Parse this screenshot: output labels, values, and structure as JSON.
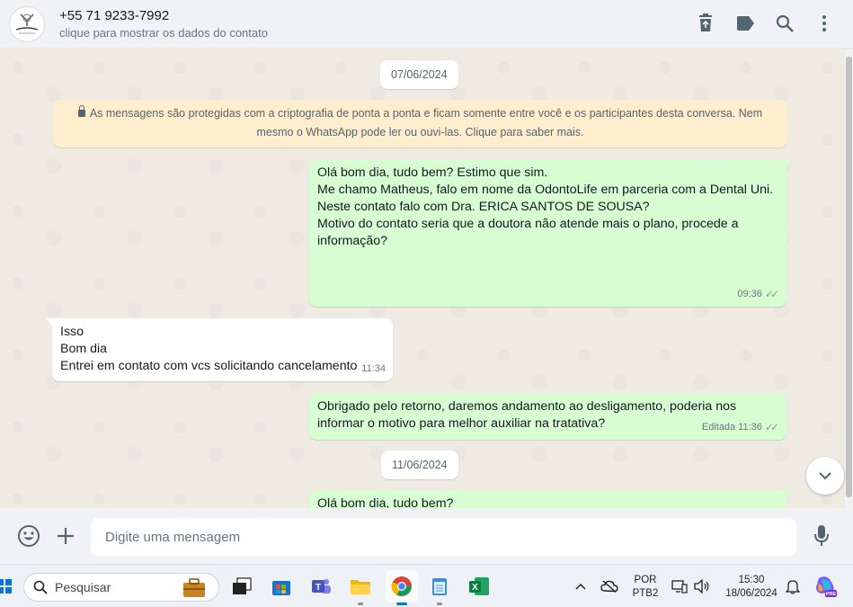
{
  "header": {
    "contact_name": "+55 71 9233-7992",
    "contact_subtitle": "clique para mostrar os dados do contato",
    "icons": [
      "delete-icon",
      "label-icon",
      "search-icon",
      "menu-icon"
    ]
  },
  "chat": {
    "date1": "07/06/2024",
    "notice": "As mensagens são protegidas com a criptografia de ponta a ponta e ficam somente entre você e os participantes desta conversa. Nem mesmo o WhatsApp pode ler ou ouvi-las. Clique para saber mais.",
    "msg1": {
      "p1": "Olá bom dia, tudo bem? Estimo que sim.",
      "p2": "Me chamo Matheus, falo em nome da OdontoLife em parceria com a Dental Uni.",
      "p3": "Neste contato falo com Dra. ERICA SANTOS DE SOUSA?",
      "p4a": "Motivo do contato seria que a doutora não atende mais o plano, procede a",
      "p4b": "informação?",
      "time": "09:36"
    },
    "msg2": {
      "l1": "Isso",
      "l2": "Bom dia",
      "l3": "Entrei em contato com vcs solicitando cancelamento",
      "time": "11:34"
    },
    "msg3": {
      "l1": "Obrigado pelo retorno, daremos andamento ao desligamento, poderia nos",
      "l2": "informar o motivo para melhor auxiliar na tratativa?",
      "edited": "Editada",
      "time": "11:36"
    },
    "date2": "11/06/2024",
    "msg4": {
      "l1": "Olá bom dia, tudo bem?"
    }
  },
  "composer": {
    "placeholder": "Digite uma mensagem",
    "value": ""
  },
  "taskbar": {
    "search_label": "Pesquisar",
    "lang_top": "POR",
    "lang_bottom": "PTB2",
    "time": "15:30",
    "date": "18/06/2024",
    "copilot_badge": "PRE"
  },
  "colors": {
    "outgoing_bubble": "#d9fdd3",
    "incoming_bubble": "#ffffff",
    "notice_bg": "#ffeecd",
    "chat_bg": "#efeae2"
  }
}
